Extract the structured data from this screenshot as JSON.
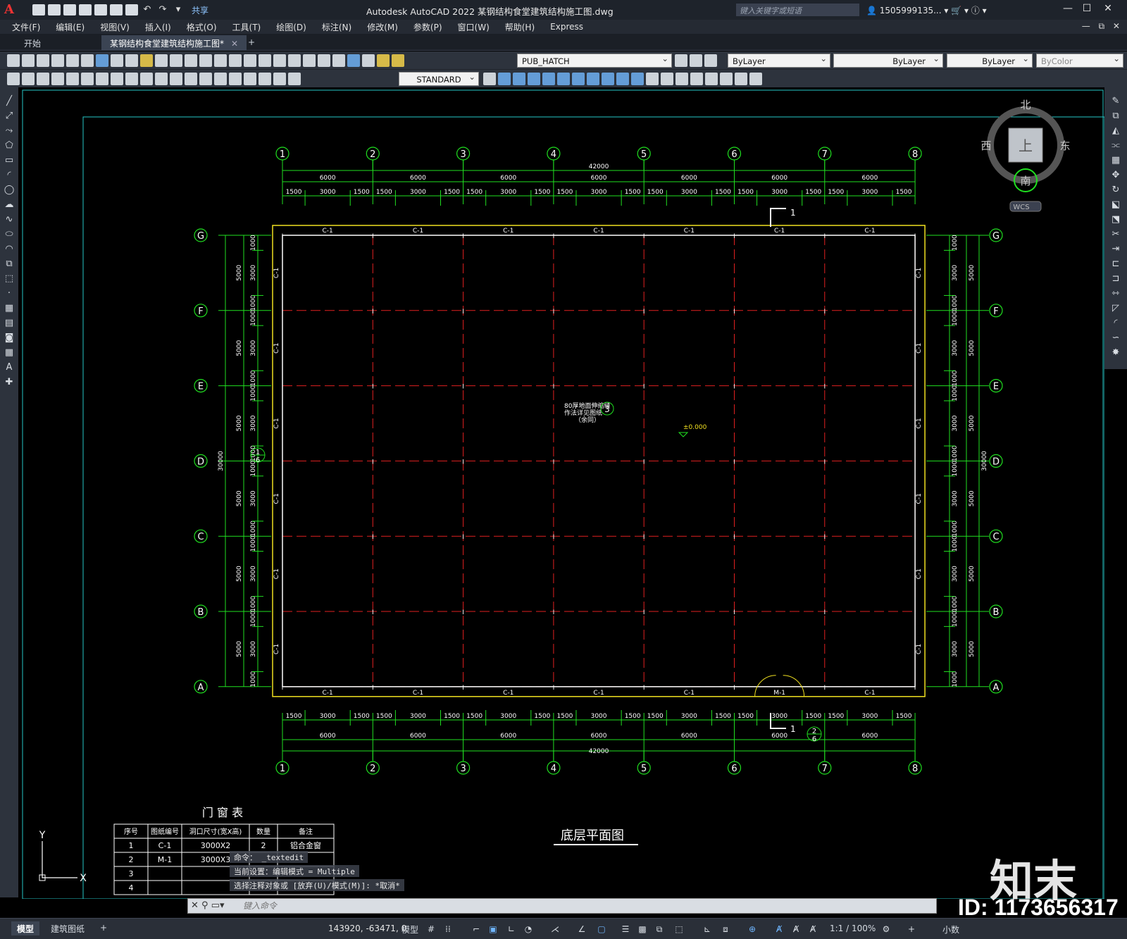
{
  "app": {
    "title": "Autodesk AutoCAD 2022    某钢结构食堂建筑结构施工图.dwg",
    "share": "共享",
    "search_placeholder": "键入关键字或短语",
    "user": "1505999135...",
    "logo": "A"
  },
  "menu": [
    "文件(F)",
    "编辑(E)",
    "视图(V)",
    "插入(I)",
    "格式(O)",
    "工具(T)",
    "绘图(D)",
    "标注(N)",
    "修改(M)",
    "参数(P)",
    "窗口(W)",
    "帮助(H)",
    "Express"
  ],
  "tabs": [
    {
      "label": "开始",
      "active": false
    },
    {
      "label": "某钢结构食堂建筑结构施工图*",
      "active": true
    }
  ],
  "toolbar": {
    "layer": "PUB_HATCH",
    "color": "ByLayer",
    "linetype": "ByLayer",
    "lineweight": "ByLayer",
    "plotstyle": "ByColor",
    "textstyle": "STANDARD"
  },
  "viewcube": {
    "north": "北",
    "south": "南",
    "east": "东",
    "west": "西",
    "top": "上",
    "wcs": "WCS"
  },
  "drawing": {
    "grid_cols": [
      "1",
      "2",
      "3",
      "4",
      "5",
      "6",
      "7",
      "8"
    ],
    "grid_rows": [
      "G",
      "F",
      "E",
      "D",
      "C",
      "B",
      "A"
    ],
    "total_width": "42000",
    "bay_dims": [
      "6000",
      "6000",
      "6000",
      "6000",
      "6000",
      "6000",
      "6000"
    ],
    "sub_dims": [
      "1500",
      "3000",
      "1500"
    ],
    "total_depth": "30000",
    "row_dims": [
      "5000",
      "5000",
      "5000",
      "5000",
      "5000",
      "5000"
    ],
    "row_sub": [
      "1000",
      "3000",
      "1000"
    ],
    "window_tag": "C-1",
    "door_tag": "M-1",
    "elevation": "±0.000",
    "section_mark": "1",
    "detail_note": [
      "80厚地面伸缩缝",
      "作法详见图纸",
      "（余同）"
    ],
    "detail_bubble": "3",
    "callout_top": "1",
    "callout_bottom": "6",
    "callout_door_top": "2",
    "callout_door_bottom": "6",
    "plan_title": "底层平面图"
  },
  "door_window_table": {
    "title": "门 窗 表",
    "headers": [
      "序号",
      "图纸编号",
      "洞口尺寸(宽X高)",
      "数量",
      "备注"
    ],
    "rows": [
      [
        "1",
        "C-1",
        "3000X2",
        "2",
        "铝合金窗"
      ],
      [
        "2",
        "M-1",
        "3000X3",
        "",
        ""
      ],
      [
        "3",
        "",
        "",
        "",
        ""
      ],
      [
        "4",
        "",
        "",
        "",
        ""
      ]
    ]
  },
  "command": {
    "history": [
      "命令： _textedit",
      "当前设置：编辑模式 = Multiple",
      "选择注释对象或 [放弃(U)/模式(M)]: *取消*"
    ],
    "placeholder": "键入命令"
  },
  "status": {
    "model_tab": "模型",
    "layout_tab": "建筑图纸",
    "coords": "143920, -63471, 0",
    "space": "模型",
    "scale": "1:1 / 100%",
    "units": "小数"
  },
  "ucs": {
    "x": "X",
    "y": "Y"
  },
  "watermark": {
    "logo": "知末",
    "id": "ID: 1173656317"
  }
}
